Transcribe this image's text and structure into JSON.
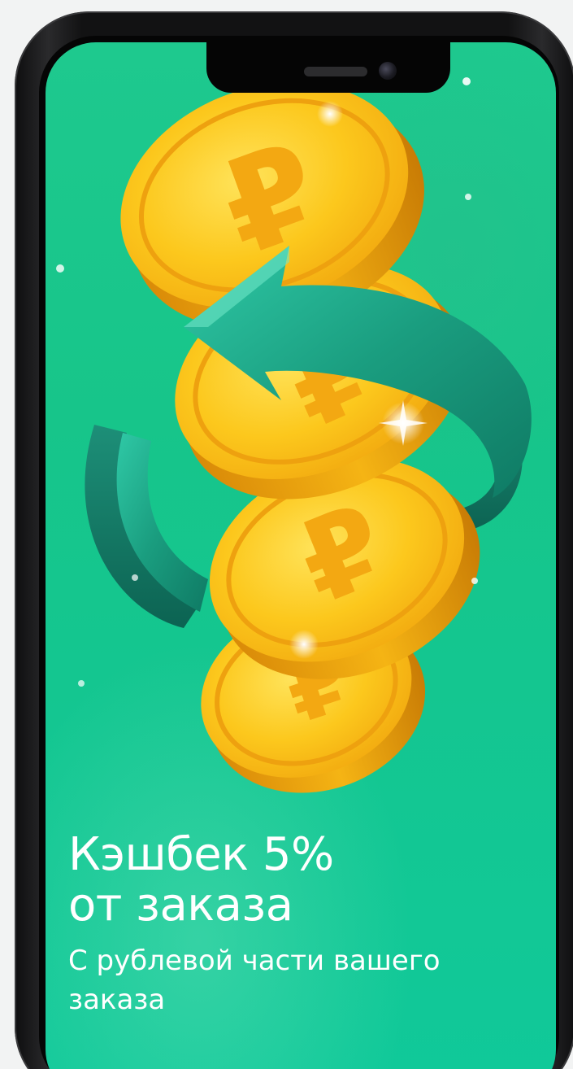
{
  "banner": {
    "title_line1": "Кэшбек 5%",
    "title_line2": "от заказа",
    "subtitle_line1": "С рублевой части вашего",
    "subtitle_line2": "заказа"
  },
  "colors": {
    "screen_green": "#17c58a",
    "coin_gold": "#f7c41a",
    "coin_edge": "#e49a0c",
    "arrow_teal": "#1aa385"
  },
  "icons": {
    "coin_symbol": "ruble-sign-icon",
    "arrow": "refresh-arrow-icon"
  }
}
